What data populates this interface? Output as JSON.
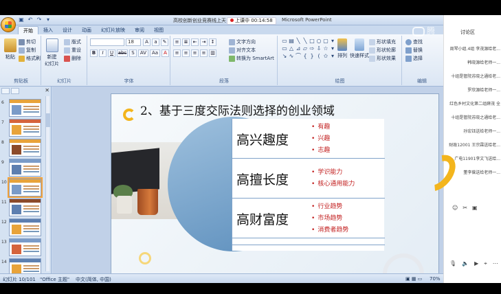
{
  "window": {
    "title": "高校创新创业竞赛线上天",
    "app_name": "Microsoft PowerPoint",
    "recording_label": "上课中",
    "recording_time": "00:14:58"
  },
  "ribbon": {
    "tabs": [
      "开始",
      "插入",
      "设计",
      "动画",
      "幻灯片放映",
      "审阅",
      "视图"
    ],
    "active_tab": 0,
    "clipboard": {
      "paste": "粘贴",
      "cut": "剪切",
      "copy": "复制",
      "format_painter": "格式刷",
      "label": "剪贴板"
    },
    "slides": {
      "new_slide": "新建\n幻灯片",
      "layout": "版式",
      "reset": "重设",
      "delete": "删除",
      "label": "幻灯片"
    },
    "font": {
      "font_name": "",
      "font_size": "18",
      "bold": "B",
      "italic": "I",
      "underline": "U",
      "strike": "abc",
      "shadow": "S",
      "spacing": "AV",
      "case": "Aa",
      "label": "字体"
    },
    "paragraph": {
      "text_direction": "文字方向",
      "align_text": "对齐文本",
      "smartart": "转换为 SmartArt",
      "label": "段落"
    },
    "drawing": {
      "arrange": "排列",
      "quick_styles": "快速样式",
      "shape_fill": "形状填充",
      "shape_outline": "形状轮廓",
      "shape_effects": "形状效果",
      "label": "绘图"
    },
    "editing": {
      "find": "查找",
      "replace": "替换",
      "select": "选择",
      "label": "编辑"
    }
  },
  "thumbnails": {
    "numbers": [
      "6",
      "7",
      "8",
      "9",
      "10",
      "11",
      "12",
      "13",
      "14"
    ],
    "active_index": 4
  },
  "slide": {
    "title": "2、基于三度交际法则选择的创业领域",
    "rows": [
      {
        "label": "高兴趣度",
        "bullets": [
          "有趣",
          "兴趣",
          "志趣"
        ]
      },
      {
        "label": "高擅长度",
        "bullets": [
          "学识能力",
          "核心通用能力"
        ]
      },
      {
        "label": "高财富度",
        "bullets": [
          "行业趋势",
          "市场趋势",
          "消费者趋势"
        ]
      }
    ]
  },
  "status": {
    "slide_counter": "幻灯片 10/101",
    "theme": "\"Office 主题\"",
    "language": "中文(简体, 中国)",
    "zoom": "70%"
  },
  "chat": {
    "title": "讨论区",
    "messages": [
      "周琴小组.4组 李茂源给老...",
      "韩晓源给老师一...",
      "十组是管院苏晓之通给老...",
      "罗欣源给老师一...",
      "红色乡村文化第二组薛茂 全 ",
      "十组是管院苏晓之通给老...",
      "孙宏钰送给老师一...",
      "财政12001 王宗霖送给老...",
      "广电11901李文飞送给...",
      "董李葆送给老师一..."
    ],
    "watermark": "腾"
  },
  "colors": {
    "accent_yellow": "#f3b51d",
    "bullet_red": "#c21f1f",
    "disc_blue": "#5d8fbd",
    "ribbon_blue": "#c9d9ee"
  }
}
